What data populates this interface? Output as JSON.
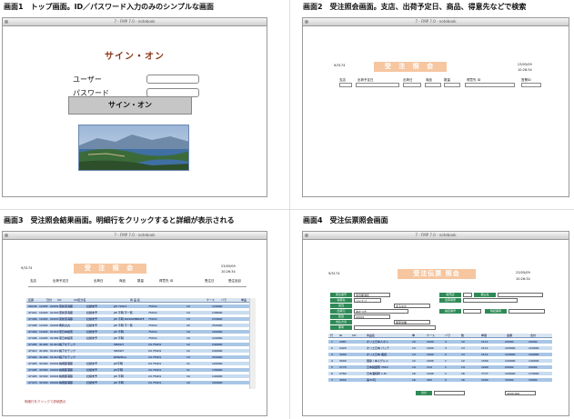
{
  "captions": {
    "c1": "画面1　トップ画面。ID／パスワード入力のみのシンプルな画面",
    "c2": "画面2　受注照会画面。支店、出荷予定日、商品、得意先などで検索",
    "c3": "画面3　受注照会結果画面。明細行をクリックすると詳細が表示される",
    "c4": "画面4　受注伝票照会画面"
  },
  "window_title": "7 - FMP 7.0 - notebook",
  "screen1": {
    "title": "サイン・オン",
    "user_label": "ユーザー",
    "password_label": "パスワード",
    "signon_button": "サイン・オン"
  },
  "screen2": {
    "header": "受 注 照 会",
    "date": "23/05/09",
    "time": "10:26:34",
    "left_code": "9/3174",
    "fields": [
      "支店",
      "出荷予定日",
      "出荷日",
      "商品",
      "数量",
      "得意先 ID",
      "営業ID"
    ]
  },
  "screen3": {
    "header": "受 注 照 会",
    "date": "23/05/09",
    "time": "10:26:34",
    "left_code": "9/3174",
    "search_labels": [
      "支店",
      "出荷予定日",
      "出荷日",
      "商品",
      "数量",
      "得意先 ID",
      "受注日",
      "受注品目"
    ],
    "columns": [
      "伝票",
      "日付",
      "CD",
      "CD区分名",
      "商 品 名",
      "ケース",
      "バラ",
      "単品"
    ],
    "rows": [
      [
        "09105",
        "10455",
        "00001",
        "東新東海藤",
        "社検未予",
        "JW 720ml",
        "750ml",
        "10",
        "120000"
      ],
      [
        "47421",
        "10403",
        "01043",
        "東新東海藤",
        "社検未予",
        "JW 不明 不一覧",
        "750ml",
        "13",
        "138000"
      ],
      [
        "47406",
        "10455",
        "00003",
        "東新東海藤",
        "社検未予",
        "JW 不明 ROSIOMBRATE",
        "750ml",
        "13",
        "234000"
      ],
      [
        "47408",
        "10403",
        "00004",
        "角新丸丸",
        "社検未予",
        "JW 不明 不一覧",
        "750ml",
        "20",
        "250000"
      ],
      [
        "47409",
        "10403",
        "01016",
        "東日本検索",
        "社検未予",
        "JW 不明",
        "750ml",
        "10",
        "160000"
      ],
      [
        "47406",
        "10403",
        "01081",
        "東日本検索",
        "社検未予",
        "JW 不明",
        "750ml",
        "10",
        "120000"
      ],
      [
        "47405",
        "41400",
        "01410",
        "株アオテック",
        "",
        "SMASH",
        "24 750ml",
        "12",
        "240000"
      ],
      [
        "47412",
        "41400",
        "01011",
        "株アオテック",
        "",
        "SMASH",
        "24 750ml",
        "12",
        "240000"
      ],
      [
        "47400",
        "41400",
        "01010",
        "株アオテック",
        "",
        "RMWPine",
        "24 750ml",
        "13",
        "250000"
      ],
      [
        "47405",
        "32300",
        "00001",
        "株鳳藤浦藤",
        "社検未予",
        "JW不明",
        "24 750ml",
        "11",
        "100000"
      ],
      [
        "47495",
        "32300",
        "00001",
        "株鳳藤浦藤",
        "社検未予",
        "JW不明",
        "24 750ml",
        "11",
        "136000"
      ],
      [
        "47405",
        "32300",
        "00001",
        "株鳳藤浦藤",
        "社検未予",
        "JW 不明",
        "24 750ml",
        "10",
        "140000"
      ],
      [
        "47470",
        "32300",
        "00001",
        "株鳳藤浦藤",
        "社検未予",
        "JW 不明",
        "24 750ml",
        "10",
        "160000"
      ]
    ],
    "footnote": "明細行をクリックで詳細表示"
  },
  "screen4": {
    "header": "受注伝票 照会",
    "date": "23/05/09",
    "time": "10:26:34",
    "left_code": "9/3174",
    "labels": [
      "受注番号",
      "得意先",
      "担当",
      "出荷元",
      "配送",
      "支払方法",
      "備考",
      "販売店",
      "出荷場所",
      "振込先",
      "指定番号",
      "特記事項"
    ],
    "field_values": [
      "東京都港区",
      "ジャスコ",
      "まるなか",
      "あかつき",
      "00001",
      "関東営業"
    ],
    "columns": [
      "行",
      "ID",
      "CD",
      "商品名",
      "単",
      "ケース",
      "バラ",
      "数",
      "単価",
      "金額",
      "合計"
    ],
    "rows": [
      [
        "1",
        "2087",
        "",
        "オリエ日本人ボト",
        "10",
        "1000",
        "4",
        "10",
        "1111",
        "20000",
        "20000"
      ],
      [
        "2",
        "2424",
        "",
        "オリエ日本 パッテ",
        "13",
        "1000",
        "3",
        "13",
        "1111",
        "120000",
        "120000"
      ],
      [
        "3",
        "3004",
        "",
        "オリエ日本 瓶詰",
        "13",
        "1000",
        "2",
        "13",
        "1111",
        "120000",
        "100000"
      ],
      [
        "4",
        "3000",
        "",
        "国産 / 本人グルメ",
        "12",
        "1000",
        "1",
        "12",
        "1500",
        "120000",
        "140000"
      ],
      [
        "5",
        "2774",
        "",
        "日本製国際 7010",
        "14",
        "124",
        "1",
        "14",
        "1000",
        "20000",
        "20000"
      ],
      [
        "6",
        "2762",
        "",
        "日本酒純粋 1.8l",
        "16",
        "1200",
        "1",
        "16",
        "7777",
        "120000",
        "170000"
      ],
      [
        "7",
        "3004",
        "",
        "第33円",
        "16",
        "400",
        "0",
        "16",
        "1000",
        "10000",
        "10000"
      ]
    ],
    "total_label": "合計",
    "total_value": "4200,000"
  }
}
